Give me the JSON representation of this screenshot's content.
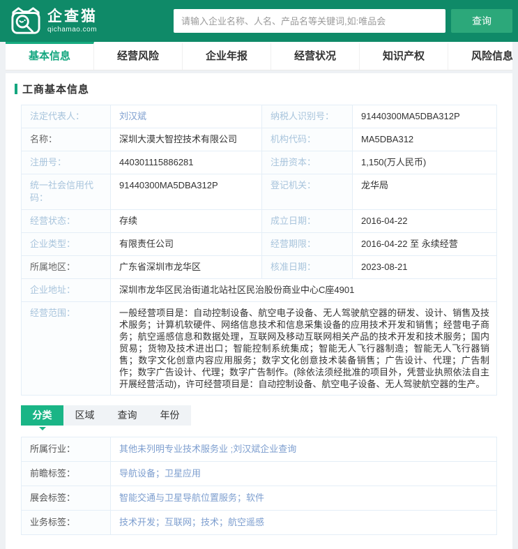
{
  "brand": {
    "name": "企查猫",
    "domain": "qichamao.com",
    "logo_icon": "cat-magnifier"
  },
  "search": {
    "placeholder": "请输入企业名称、人名、产品名等关键词,如:唯品会",
    "button_label": "查询"
  },
  "nav": {
    "tabs": [
      {
        "label": "基本信息",
        "active": true
      },
      {
        "label": "经营风险",
        "active": false
      },
      {
        "label": "企业年报",
        "active": false
      },
      {
        "label": "经营状况",
        "active": false
      },
      {
        "label": "知识产权",
        "active": false
      },
      {
        "label": "风险信息",
        "active": false
      }
    ]
  },
  "section_title": "工商基本信息",
  "company": {
    "rows": [
      {
        "cells": [
          {
            "label": "法定代表人：",
            "tone": "light",
            "value": "刘汉斌",
            "link": true
          },
          {
            "label": "纳税人识别号：",
            "tone": "light",
            "value": "91440300MA5DBA312P"
          }
        ]
      },
      {
        "cells": [
          {
            "label": "名称：",
            "tone": "dark",
            "value": "深圳大漠大智控技术有限公司"
          },
          {
            "label": "机构代码：",
            "tone": "light",
            "value": "MA5DBA312"
          }
        ]
      },
      {
        "cells": [
          {
            "label": "注册号：",
            "tone": "light",
            "value": "440301115886281"
          },
          {
            "label": "注册资本：",
            "tone": "light",
            "value": "1,150(万人民币)"
          }
        ]
      },
      {
        "cells": [
          {
            "label": "统一社会信用代码：",
            "tone": "light",
            "value": "91440300MA5DBA312P"
          },
          {
            "label": "登记机关：",
            "tone": "light",
            "value": "龙华局"
          }
        ]
      },
      {
        "cells": [
          {
            "label": "经营状态：",
            "tone": "light",
            "value": "存续"
          },
          {
            "label": "成立日期：",
            "tone": "light",
            "value": "2016-04-22"
          }
        ]
      },
      {
        "cells": [
          {
            "label": "企业类型：",
            "tone": "light",
            "value": "有限责任公司"
          },
          {
            "label": "经营期限：",
            "tone": "light",
            "value": "2016-04-22 至 永续经营"
          }
        ]
      },
      {
        "cells": [
          {
            "label": "所属地区：",
            "tone": "dark",
            "value": "广东省深圳市龙华区"
          },
          {
            "label": "核准日期：",
            "tone": "light",
            "value": "2023-08-21"
          }
        ]
      },
      {
        "cells": [
          {
            "label": "企业地址：",
            "tone": "light",
            "value": "深圳市龙华区民治街道北站社区民治股份商业中心C座4901"
          }
        ]
      },
      {
        "cells": [
          {
            "label": "经营范围：",
            "tone": "light",
            "multiline": true,
            "value": "一般经营项目是：自动控制设备、航空电子设备、无人驾驶航空器的研发、设计、销售及技术服务；计算机软硬件、网络信息技术和信息采集设备的应用技术开发和销售；经营电子商务；航空遥感信息和数据处理，互联网及移动互联网相关产品的技术开发和技术服务；国内贸易；货物及技术进出口；智能控制系统集成；智能无人飞行器制造；智能无人飞行器销售；数字文化创意内容应用服务；数字文化创意技术装备销售；广告设计、代理；广告制作；数字广告设计、代理；数字广告制作。(除依法须经批准的项目外，凭营业执照依法自主开展经营活动)，许可经营项目是：自动控制设备、航空电子设备、无人驾驶航空器的生产。"
          }
        ]
      }
    ]
  },
  "subtabs": [
    {
      "label": "分类",
      "active": true
    },
    {
      "label": "区域",
      "active": false
    },
    {
      "label": "查询",
      "active": false
    },
    {
      "label": "年份",
      "active": false
    }
  ],
  "tags": {
    "rows": [
      {
        "label": "所属行业：",
        "value": "其他未列明专业技术服务业 ;刘汉斌企业查询"
      },
      {
        "label": "前瞻标签：",
        "value": "导航设备；卫星应用"
      },
      {
        "label": "展会标签：",
        "value": "智能交通与卫星导航位置服务；软件"
      },
      {
        "label": "业务标签：",
        "value": "技术开发；互联网；技术；航空遥感"
      }
    ]
  },
  "colors": {
    "header_green": "#0f8a68",
    "search_button_green": "#2ca87a",
    "nav_active_green": "#14a67f",
    "subtab_active_green": "#1ab586",
    "label_blue": "#a8c4dc",
    "link_blue": "#7d9ecf",
    "table_border": "#e4eef7"
  }
}
